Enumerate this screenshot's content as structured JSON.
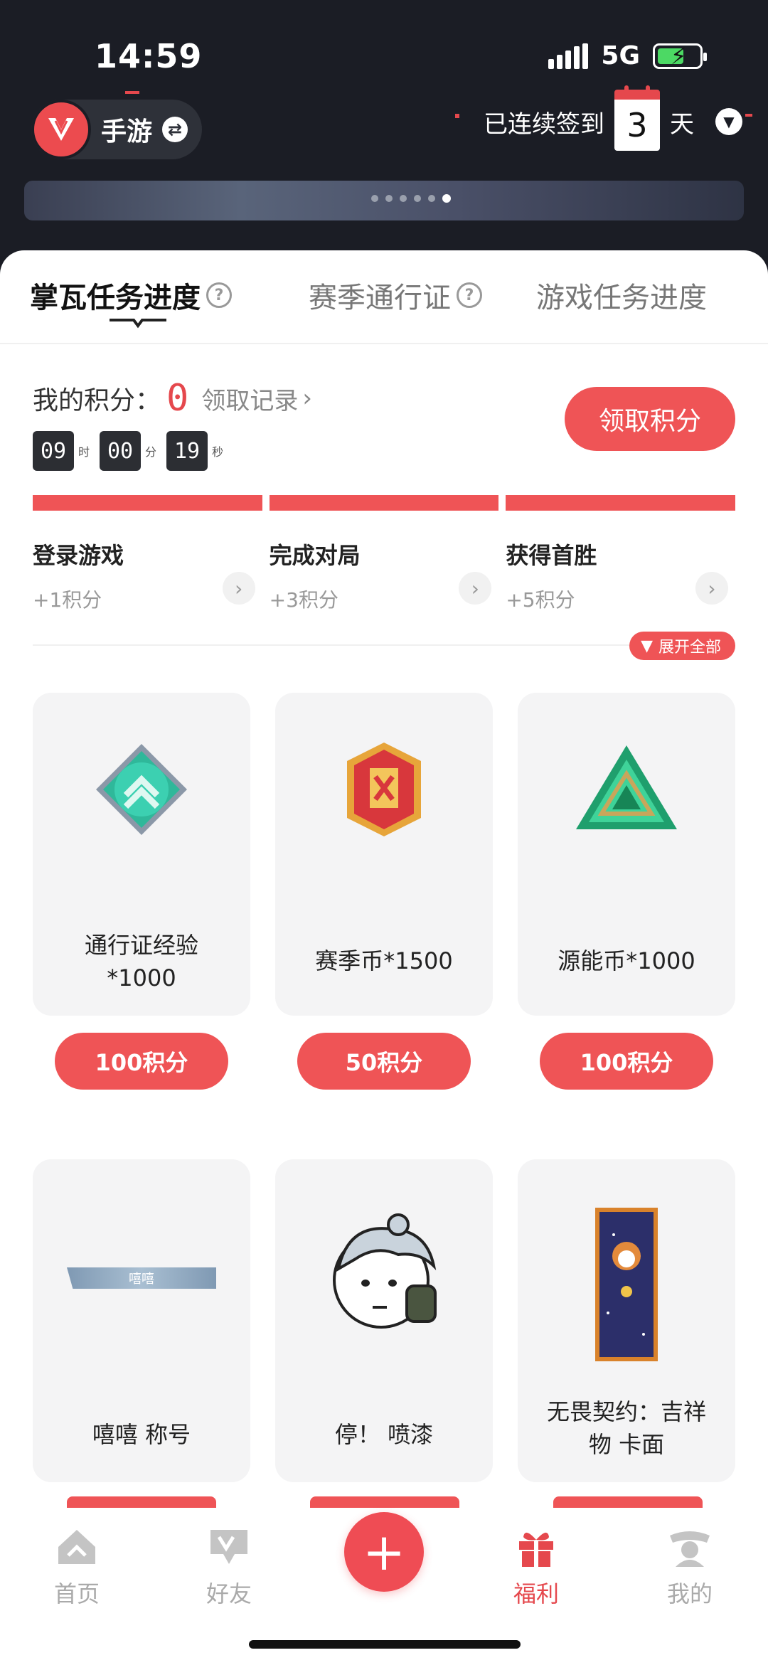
{
  "status_bar": {
    "time": "14:59",
    "network": "5G"
  },
  "header": {
    "mode_label": "手游",
    "checkin_prefix": "已连续签到",
    "checkin_days": "3",
    "checkin_suffix": "天"
  },
  "tabs": [
    {
      "label": "掌瓦任务进度",
      "active": true
    },
    {
      "label": "赛季通行证",
      "active": false
    },
    {
      "label": "游戏任务进度",
      "active": false
    }
  ],
  "points": {
    "label": "我的积分：",
    "value": "0",
    "record_label": "领取记录",
    "claim_button": "领取积分",
    "countdown": {
      "hours": "09",
      "hours_unit": "时",
      "minutes": "00",
      "minutes_unit": "分",
      "seconds": "19",
      "seconds_unit": "秒"
    }
  },
  "tasks": [
    {
      "name": "登录游戏",
      "reward": "+1积分"
    },
    {
      "name": "完成对局",
      "reward": "+3积分"
    },
    {
      "name": "获得首胜",
      "reward": "+5积分"
    }
  ],
  "expand_label": "展开全部",
  "rewards": [
    {
      "name_line1": "通行证经验",
      "name_line2": "*1000",
      "cost": "100积分",
      "icon": "pass-exp-icon"
    },
    {
      "name_line1": "赛季币*1500",
      "name_line2": "",
      "cost": "50积分",
      "icon": "season-coin-icon"
    },
    {
      "name_line1": "源能币*1000",
      "name_line2": "",
      "cost": "100积分",
      "icon": "radianite-icon"
    },
    {
      "name_line1": "嘻嘻 称号",
      "name_line2": "",
      "title_badge": "嘻嘻",
      "icon": "title-card-icon"
    },
    {
      "name_line1": "停！ 喷漆",
      "name_line2": "",
      "icon": "spray-icon"
    },
    {
      "name_line1": "无畏契约：吉祥",
      "name_line2": "物 卡面",
      "icon": "player-card-icon"
    }
  ],
  "bottom_nav": [
    {
      "label": "首页",
      "icon": "home-icon",
      "active": false
    },
    {
      "label": "好友",
      "icon": "friends-icon",
      "active": false
    },
    {
      "label": "福利",
      "icon": "gift-icon",
      "active": true
    },
    {
      "label": "我的",
      "icon": "profile-icon",
      "active": false
    }
  ],
  "colors": {
    "accent": "#ef5456",
    "header_bg": "#1b1d25"
  }
}
